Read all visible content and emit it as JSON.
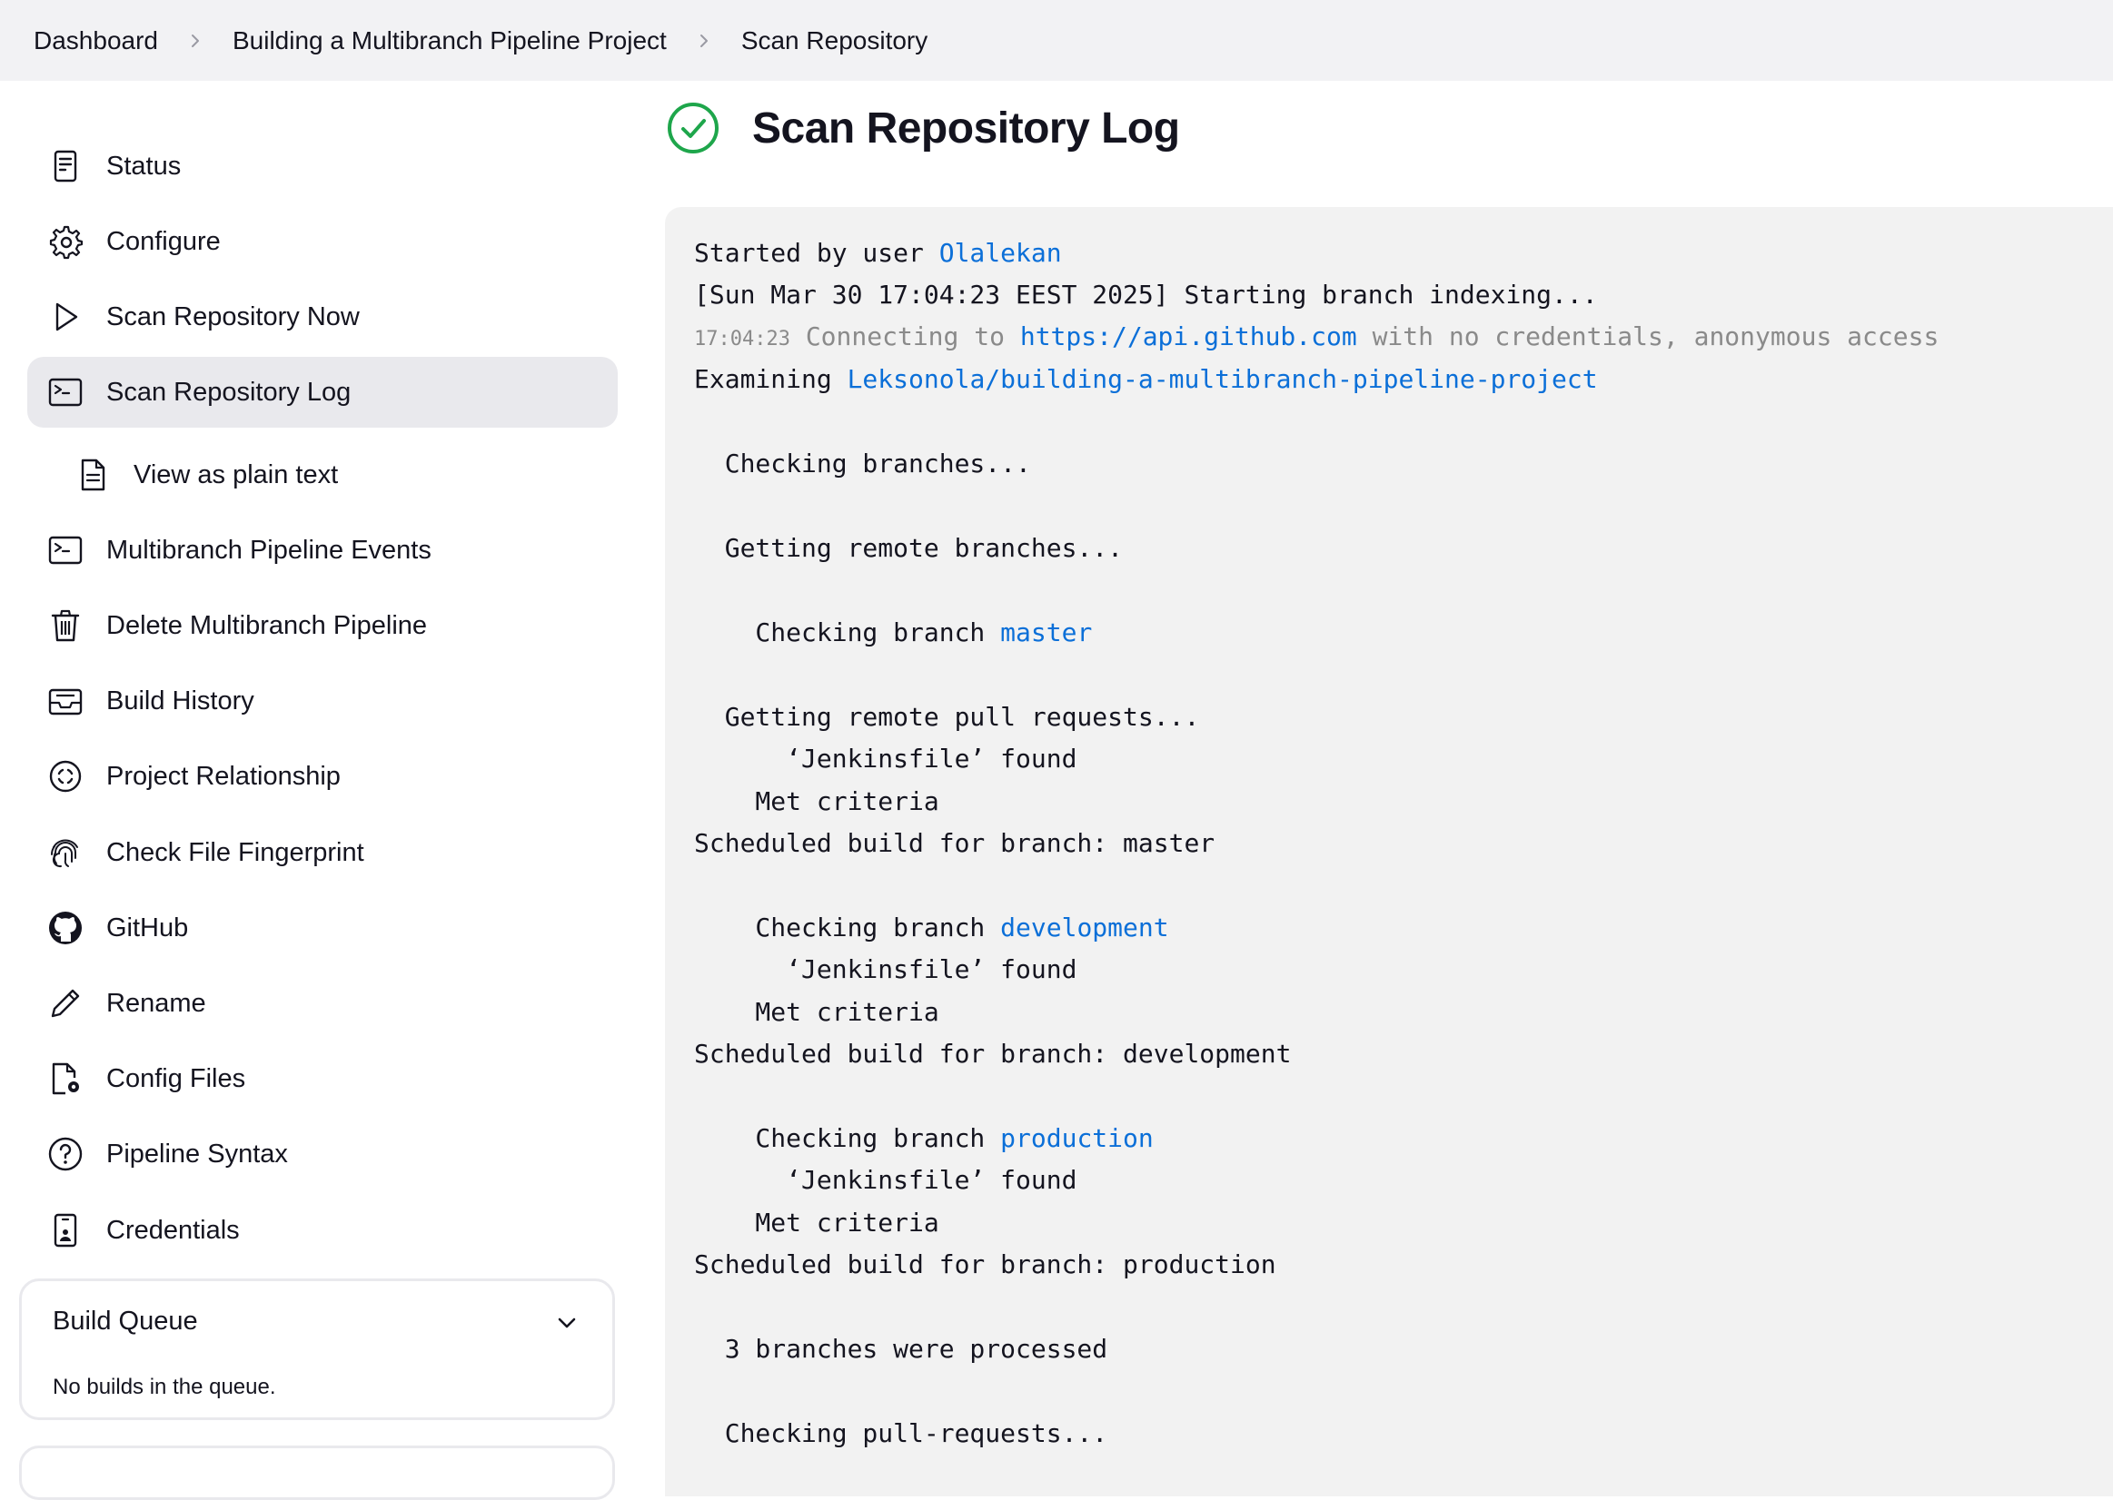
{
  "breadcrumbs": [
    "Dashboard",
    "Building a Multibranch Pipeline Project",
    "Scan Repository"
  ],
  "sidebar": {
    "items": [
      {
        "label": "Status",
        "icon": "document-icon"
      },
      {
        "label": "Configure",
        "icon": "gear-icon"
      },
      {
        "label": "Scan Repository Now",
        "icon": "play-icon"
      },
      {
        "label": "Scan Repository Log",
        "icon": "terminal-icon",
        "active": true
      },
      {
        "label": "View as plain text",
        "icon": "file-text-icon",
        "sub": true
      },
      {
        "label": "Multibranch Pipeline Events",
        "icon": "terminal-icon"
      },
      {
        "label": "Delete Multibranch Pipeline",
        "icon": "trash-icon"
      },
      {
        "label": "Build History",
        "icon": "inbox-icon"
      },
      {
        "label": "Project Relationship",
        "icon": "relationship-icon"
      },
      {
        "label": "Check File Fingerprint",
        "icon": "fingerprint-icon"
      },
      {
        "label": "GitHub",
        "icon": "github-icon"
      },
      {
        "label": "Rename",
        "icon": "pencil-icon"
      },
      {
        "label": "Config Files",
        "icon": "file-gear-icon"
      },
      {
        "label": "Pipeline Syntax",
        "icon": "help-circle-icon"
      },
      {
        "label": "Credentials",
        "icon": "credentials-icon"
      }
    ]
  },
  "build_queue": {
    "title": "Build Queue",
    "empty_text": "No builds in the queue."
  },
  "page": {
    "title": "Scan Repository Log",
    "status_icon": "success-check-icon"
  },
  "log": {
    "l0a": "Started by user ",
    "l0b": "Olalekan",
    "l1": "[Sun Mar 30 17:04:23 EEST 2025] Starting branch indexing...",
    "l2ts": "17:04:23",
    "l2a": " Connecting to ",
    "l2b": "https://api.github.com",
    "l2c": " with no credentials, anonymous access",
    "l3a": "Examining ",
    "l3b": "Leksonola/building-a-multibranch-pipeline-project",
    "l4": "  Checking branches...",
    "l5": "  Getting remote branches...",
    "l6a": "    Checking branch ",
    "l6b": "master",
    "l7": "  Getting remote pull requests...",
    "l8": "      ‘Jenkinsfile’ found",
    "l9": "    Met criteria",
    "l10": "Scheduled build for branch: master",
    "l11a": "    Checking branch ",
    "l11b": "development",
    "l12": "      ‘Jenkinsfile’ found",
    "l13": "    Met criteria",
    "l14": "Scheduled build for branch: development",
    "l15a": "    Checking branch ",
    "l15b": "production",
    "l16": "      ‘Jenkinsfile’ found",
    "l17": "    Met criteria",
    "l18": "Scheduled build for branch: production",
    "l19": "  3 branches were processed",
    "l20": "  Checking pull-requests..."
  },
  "colors": {
    "link": "#0b6fd8",
    "success": "#1ea64b",
    "console_bg": "#f2f2f2",
    "active_bg": "#e9e9ed"
  }
}
